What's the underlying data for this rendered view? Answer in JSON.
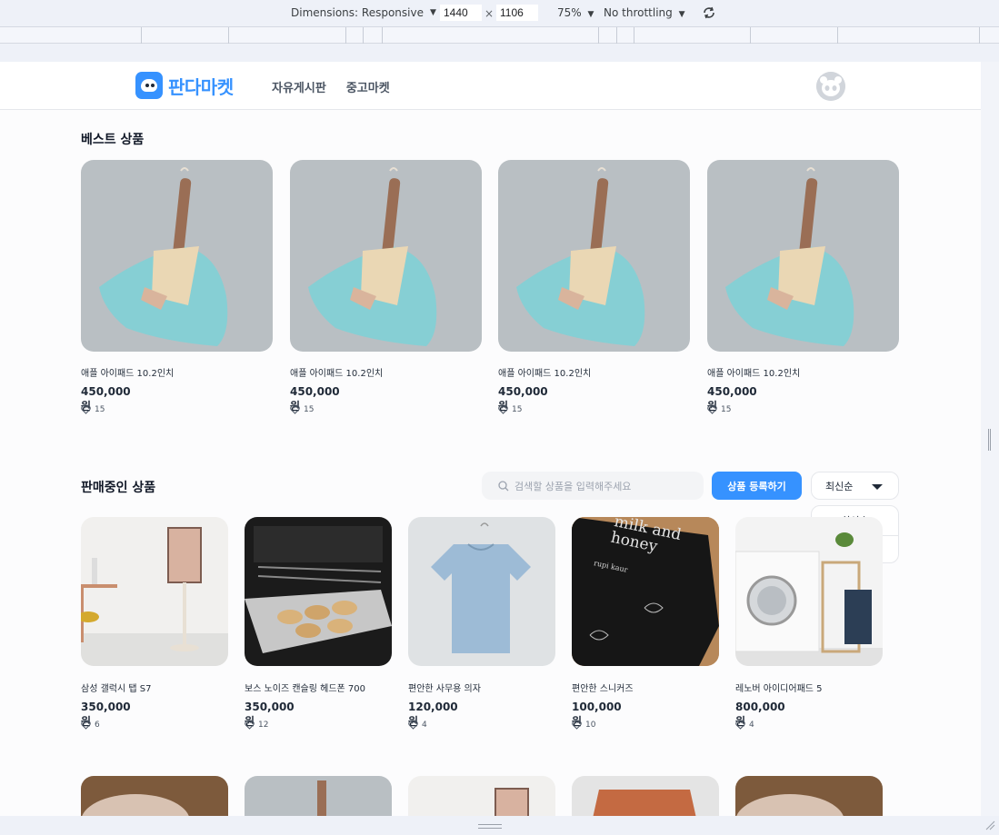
{
  "devtools": {
    "dimensions_label": "Dimensions: Responsive",
    "width": "1440",
    "height": "1106",
    "times": "×",
    "zoom": "75%",
    "throttling": "No throttling"
  },
  "header": {
    "logo_text": "판다마켓",
    "nav": [
      "자유게시판",
      "중고마켓"
    ]
  },
  "best": {
    "title": "베스트 상품",
    "items": [
      {
        "name": "애플 아이패드 10.2인치",
        "price": "450,000원",
        "likes": "15"
      },
      {
        "name": "애플 아이패드 10.2인치",
        "price": "450,000원",
        "likes": "15"
      },
      {
        "name": "애플 아이패드 10.2인치",
        "price": "450,000원",
        "likes": "15"
      },
      {
        "name": "애플 아이패드 10.2인치",
        "price": "450,000원",
        "likes": "15"
      }
    ]
  },
  "onsale": {
    "title": "판매중인 상품",
    "search_placeholder": "검색할 상품을 입력해주세요",
    "register_label": "상품 등록하기",
    "sort_selected": "최신순",
    "sort_options": [
      "최신순",
      "좋아요순"
    ],
    "items": [
      {
        "name": "삼성 갤럭시 탭 S7",
        "price": "350,000원",
        "likes": "6"
      },
      {
        "name": "보스 노이즈 캔슬링 헤드폰 700",
        "price": "350,000원",
        "likes": "12"
      },
      {
        "name": "편안한 사무용 의자",
        "price": "120,000원",
        "likes": "4"
      },
      {
        "name": "편안한 스니커즈",
        "price": "100,000원",
        "likes": "10"
      },
      {
        "name": "레노버 아이디어패드 5",
        "price": "800,000원",
        "likes": "4"
      }
    ],
    "book_title": "milk and honey",
    "book_author": "rupi kaur"
  },
  "colors": {
    "brand": "#3692ff",
    "page_bg": "#fcfcfd",
    "text": "#1f2937"
  }
}
